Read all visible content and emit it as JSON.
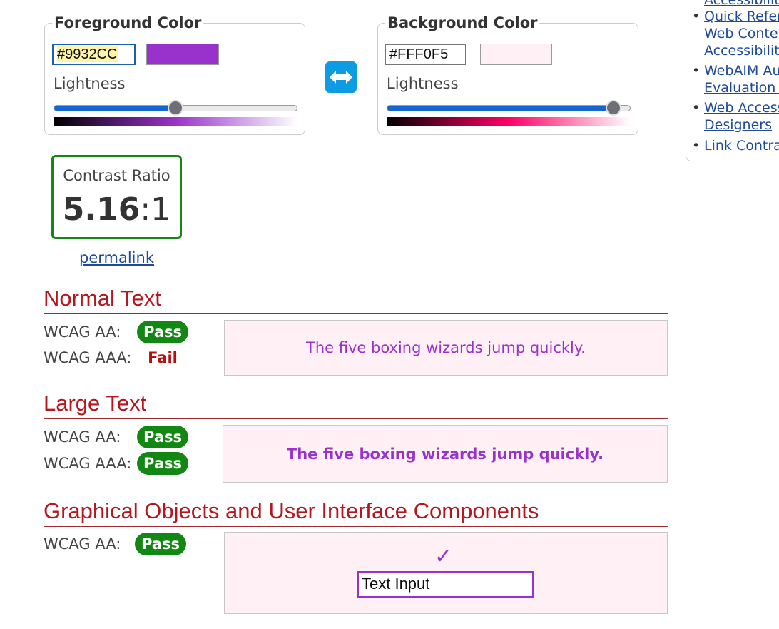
{
  "foreground": {
    "title": "Foreground Color",
    "hex_value": "#9932CC",
    "swatch_color": "#9932cc",
    "lightness_label": "Lightness",
    "lightness_value": 0.5
  },
  "background": {
    "title": "Background Color",
    "hex_value": "#FFF0F5",
    "swatch_color": "#fff0f5",
    "lightness_label": "Lightness",
    "lightness_value": 0.93
  },
  "swap_button": {
    "icon": "swap-horizontal-arrows-icon"
  },
  "contrast": {
    "label": "Contrast Ratio",
    "ratio_number": "5.16",
    "ratio_suffix": ":1"
  },
  "permalink": {
    "label": "permalink"
  },
  "sections": {
    "normal_text": {
      "title": "Normal Text",
      "aa_label": "WCAG AA:",
      "aa_result": "Pass",
      "aaa_label": "WCAG AAA:",
      "aaa_result": "Fail",
      "sample": "The five boxing wizards jump quickly."
    },
    "large_text": {
      "title": "Large Text",
      "aa_label": "WCAG AA:",
      "aa_result": "Pass",
      "aaa_label": "WCAG AAA:",
      "aaa_result": "Pass",
      "sample": "The five boxing wizards jump quickly."
    },
    "graphical": {
      "title": "Graphical Objects and User Interface Components",
      "aa_label": "WCAG AA:",
      "aa_result": "Pass",
      "check_glyph": "✓",
      "input_value": "Text Input"
    }
  },
  "sidebar": {
    "items": [
      {
        "lines": [
          "Accessibility"
        ],
        "partial_top": true
      },
      {
        "lines": [
          "Quick Refere",
          "Web Conten",
          "Accessibility"
        ]
      },
      {
        "lines": [
          "WebAIM Aud",
          "Evaluation S"
        ]
      },
      {
        "lines": [
          "Web Access",
          "Designers"
        ]
      },
      {
        "lines": [
          "Link Contras"
        ]
      }
    ]
  },
  "colors": {
    "pass_green": "#138713",
    "fail_red": "#b90e0e",
    "section_red": "#b4171d",
    "link_blue": "#1f4a98",
    "swap_blue": "#0d9be3"
  }
}
